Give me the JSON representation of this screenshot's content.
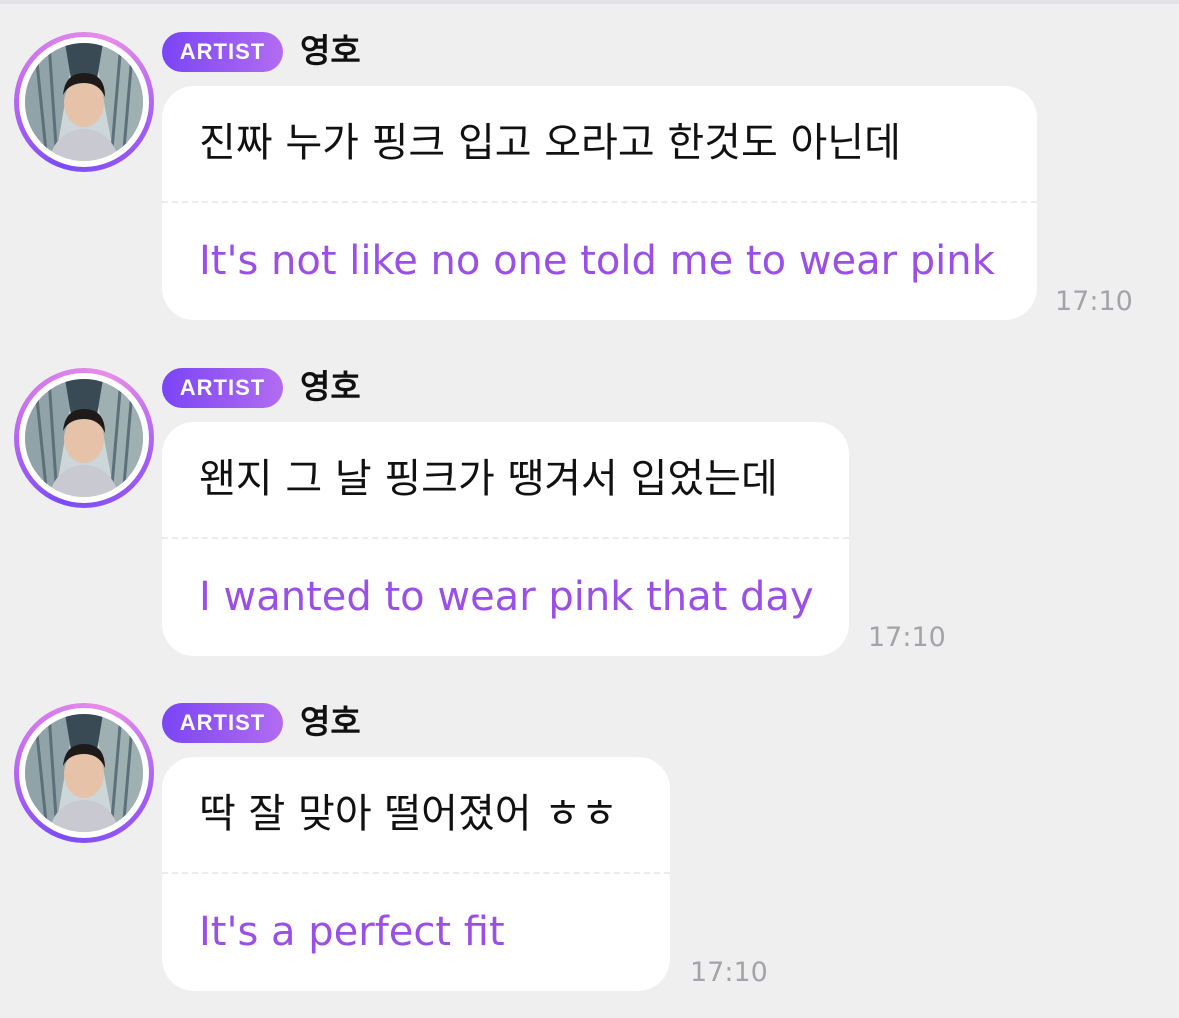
{
  "theme": {
    "background": "#efeff0",
    "bubble_background": "#ffffff",
    "translation_color": "#9a4fe6",
    "badge_gradient": [
      "#7a45f5",
      "#b26cf0"
    ],
    "timestamp_color": "#a3a3a8"
  },
  "messages": [
    {
      "badge": "ARTIST",
      "sender": "영호",
      "avatar_icon": "artist-avatar",
      "original": "진짜 누가 핑크 입고 오라고 한것도 아닌데",
      "translation": "It's not like no one told me to wear pink",
      "time": "17:10"
    },
    {
      "badge": "ARTIST",
      "sender": "영호",
      "avatar_icon": "artist-avatar",
      "original": "왠지 그 날 핑크가 땡겨서 입었는데",
      "translation": "I wanted to wear pink that day",
      "time": "17:10"
    },
    {
      "badge": "ARTIST",
      "sender": "영호",
      "avatar_icon": "artist-avatar",
      "original": "딱 잘 맞아 떨어졌어 ㅎㅎ",
      "translation": "It's a perfect fit",
      "time": "17:10"
    }
  ]
}
